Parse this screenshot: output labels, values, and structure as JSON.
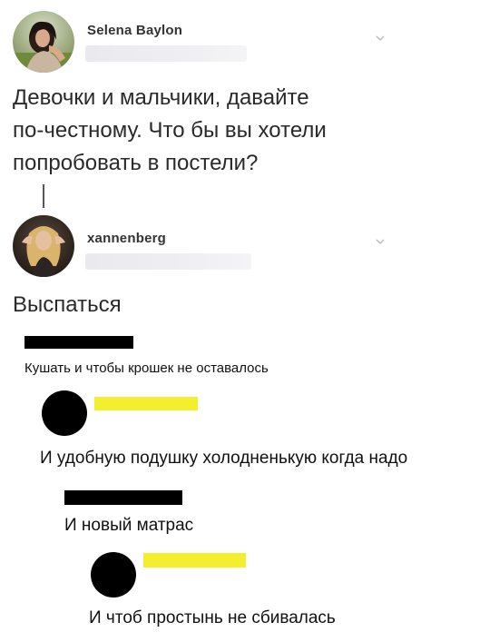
{
  "post1": {
    "username": "Selena Baylon",
    "lines": [
      "Девочки и мальчики, давайте",
      "по-честному. Что бы вы хотели",
      "попробовать в постели?"
    ]
  },
  "post2": {
    "username": "xannenberg",
    "text": "Выспаться"
  },
  "comments": [
    {
      "text": "Кушать и чтобы крошек не оставалось"
    },
    {
      "text": "И удобную подушку холодненькую когда надо"
    },
    {
      "text": "И новый матрас"
    },
    {
      "text": "И чтоб простынь не сбивалась"
    }
  ],
  "colors": {
    "redaction_black": "#000000",
    "redaction_yellow": "#f4ef2e",
    "thread_line": "#555555"
  },
  "icons": {
    "menu": "chevron-down-icon"
  }
}
